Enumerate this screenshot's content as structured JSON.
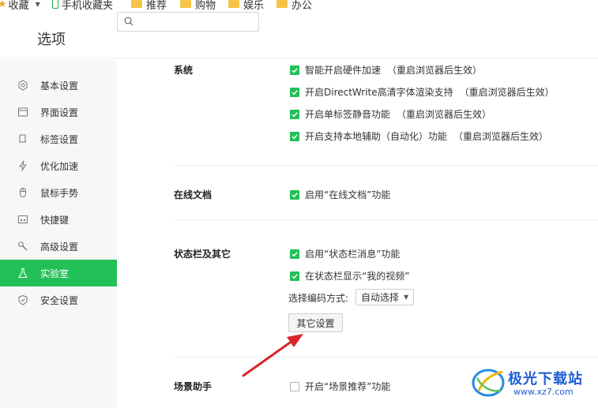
{
  "bookmarks": [
    {
      "label": "收藏",
      "icon": "star-icon"
    },
    {
      "label": "手机收藏夹",
      "icon": "phone-icon"
    },
    {
      "label": "推荐",
      "icon": "folder-icon"
    },
    {
      "label": "购物",
      "icon": "folder-icon"
    },
    {
      "label": "娱乐",
      "icon": "folder-icon"
    },
    {
      "label": "办公",
      "icon": "folder-icon"
    }
  ],
  "header": {
    "title": "选项",
    "search_placeholder": ""
  },
  "sidebar": {
    "items": [
      {
        "label": "基本设置",
        "icon": "gear-icon"
      },
      {
        "label": "界面设置",
        "icon": "window-icon"
      },
      {
        "label": "标签设置",
        "icon": "tab-icon"
      },
      {
        "label": "优化加速",
        "icon": "lightning-icon"
      },
      {
        "label": "鼠标手势",
        "icon": "mouse-icon"
      },
      {
        "label": "快捷键",
        "icon": "keyboard-icon"
      },
      {
        "label": "高级设置",
        "icon": "wrench-icon"
      },
      {
        "label": "实验室",
        "icon": "flask-icon"
      },
      {
        "label": "安全设置",
        "icon": "shield-icon"
      }
    ],
    "active_index": 7
  },
  "sections": {
    "system": {
      "title": "系统",
      "options": [
        {
          "label": "智能开启硬件加速",
          "note": "（重启浏览器后生效）",
          "checked": true
        },
        {
          "label": "开启DirectWrite高清字体渲染支持",
          "note": "（重启浏览器后生效）",
          "checked": true
        },
        {
          "label": "开启单标签静音功能",
          "note": "（重启浏览器后生效）",
          "checked": true
        },
        {
          "label": "开启支持本地辅助（自动化）功能",
          "note": "（重启浏览器后生效）",
          "checked": true
        }
      ]
    },
    "online_docs": {
      "title": "在线文档",
      "options": [
        {
          "label": "启用“在线文档”功能",
          "checked": true
        }
      ]
    },
    "statusbar": {
      "title": "状态栏及其它",
      "options": [
        {
          "label": "启用“状态栏消息”功能",
          "checked": true
        },
        {
          "label": "在状态栏显示“我的视频”",
          "checked": true
        }
      ],
      "encoding_label": "选择编码方式:",
      "encoding_value": "自动选择",
      "other_button": "其它设置"
    },
    "scene": {
      "title": "场景助手",
      "options": [
        {
          "label": "开启“场景推荐”功能",
          "checked": false
        }
      ]
    }
  },
  "colors": {
    "accent": "#23c057",
    "annotation_arrow": "#d9262c",
    "watermark": "#1f5fd1"
  },
  "watermark": {
    "brand": "极光下载站",
    "url": "www.xz7.com"
  }
}
